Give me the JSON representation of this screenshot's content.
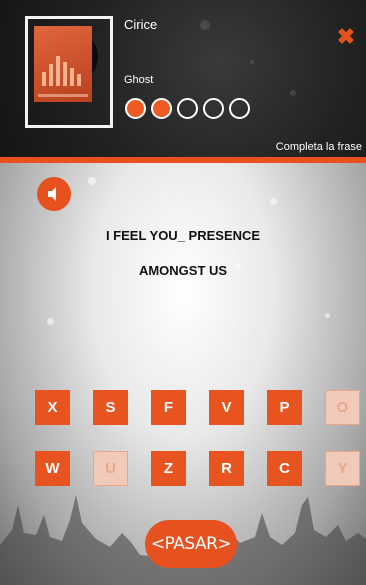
{
  "song": {
    "artist": "Cirice",
    "title": "Ghost"
  },
  "progress": {
    "completed": 2,
    "total": 5
  },
  "mode_label": "Completa la frase",
  "phrase": {
    "line1": "I FEEL YOU_ PRESENCE",
    "line2": "AMONGST US"
  },
  "keyboard": {
    "row1": [
      {
        "letter": "X",
        "used": false
      },
      {
        "letter": "S",
        "used": false
      },
      {
        "letter": "F",
        "used": false
      },
      {
        "letter": "V",
        "used": false
      },
      {
        "letter": "P",
        "used": false
      },
      {
        "letter": "O",
        "used": true
      }
    ],
    "row2": [
      {
        "letter": "W",
        "used": false
      },
      {
        "letter": "U",
        "used": true
      },
      {
        "letter": "Z",
        "used": false
      },
      {
        "letter": "R",
        "used": false
      },
      {
        "letter": "C",
        "used": false
      },
      {
        "letter": "Y",
        "used": true
      }
    ]
  },
  "skip_label": "<PASAR>",
  "close_glyph": "✖",
  "colors": {
    "accent": "#e6521f",
    "used_key": "#f1c9b8",
    "header_bg": "#222222"
  },
  "icons": {
    "close": "close-icon",
    "sound": "speaker-icon",
    "album": "album-art-icon"
  }
}
